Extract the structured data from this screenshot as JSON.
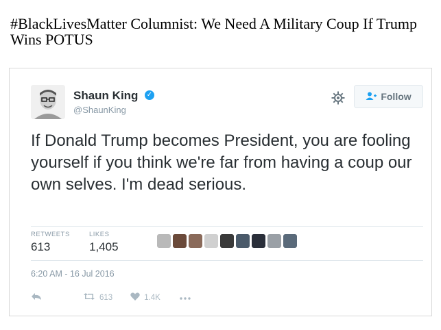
{
  "headline": "#BlackLivesMatter Columnist: We Need A Military Coup If Trump Wins POTUS",
  "tweet": {
    "user": {
      "name": "Shaun King",
      "handle": "@ShaunKing"
    },
    "follow_label": "Follow",
    "text": "If Donald Trump becomes President, you are fooling yourself if you think we're far from having a coup our own selves. I'm dead serious.",
    "stats": {
      "retweets_label": "RETWEETS",
      "retweets_value": "613",
      "likes_label": "LIKES",
      "likes_value": "1,405"
    },
    "liker_avatar_count": 9,
    "timestamp": "6:20 AM - 16 Jul 2016",
    "actions": {
      "retweet_count": "613",
      "like_count": "1.4K"
    }
  },
  "colors": {
    "accent": "#1da1f2",
    "text": "#292f33",
    "muted": "#8899a6"
  },
  "icons": [
    "verified-icon",
    "gear-icon",
    "follow-person-icon",
    "reply-icon",
    "retweet-icon",
    "heart-icon",
    "more-icon"
  ]
}
